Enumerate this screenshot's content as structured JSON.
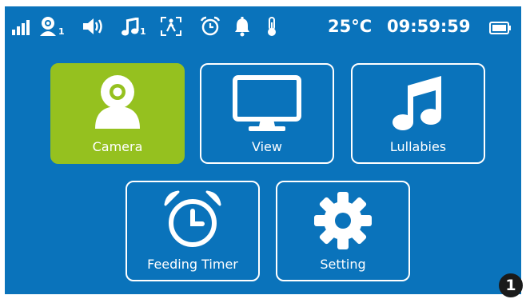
{
  "status_bar": {
    "camera_channel": "1",
    "lullaby_channel": "1",
    "temperature": "25°C",
    "time": "09:59:59",
    "icons": [
      "signal-icon",
      "camera-icon",
      "volume-icon",
      "music-icon",
      "walking-icon",
      "alarm-clock-icon",
      "bell-icon",
      "thermometer-icon",
      "battery-icon"
    ]
  },
  "menu": {
    "items": [
      {
        "label": "Camera",
        "icon": "camera-icon",
        "selected": true
      },
      {
        "label": "View",
        "icon": "monitor-icon",
        "selected": false
      },
      {
        "label": "Lullabies",
        "icon": "music-note-icon",
        "selected": false
      },
      {
        "label": "Feeding Timer",
        "icon": "alarm-clock-icon",
        "selected": false
      },
      {
        "label": "Setting",
        "icon": "gear-icon",
        "selected": false
      }
    ]
  },
  "page_marker": "1",
  "colors": {
    "background": "#0a73bb",
    "selected": "#95c11f",
    "foreground": "#ffffff",
    "marker": "#1a1a1a"
  }
}
